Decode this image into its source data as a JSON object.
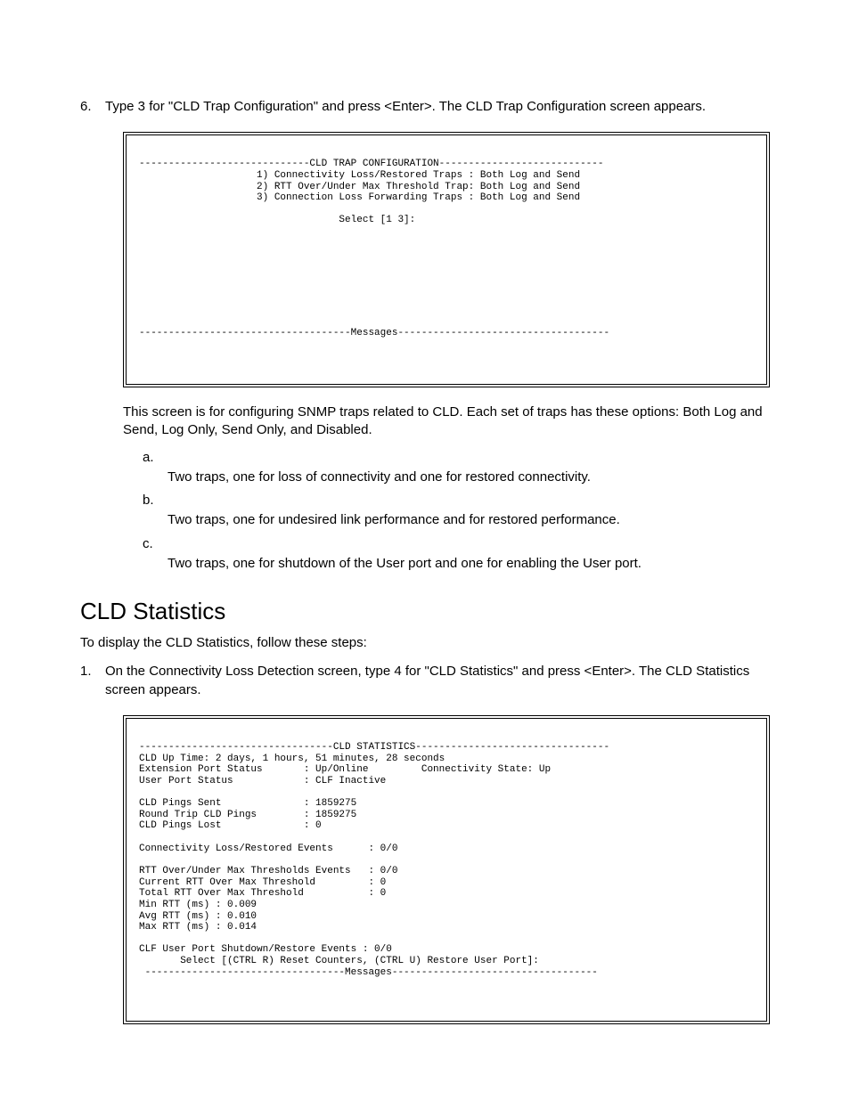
{
  "step6": {
    "num": "6.",
    "text": "Type 3 for \"CLD Trap Configuration\" and press <Enter>. The CLD Trap Configuration screen appears."
  },
  "term1": "-----------------------------CLD TRAP CONFIGURATION----------------------------\n                    1) Connectivity Loss/Restored Traps : Both Log and Send\n                    2) RTT Over/Under Max Threshold Trap: Both Log and Send\n                    3) Connection Loss Forwarding Traps : Both Log and Send\n\n                                  Select [1 3]:\n\n\n\n\n\n\n\n\n\n------------------------------------Messages------------------------------------\n\n",
  "after1": "This screen is for configuring SNMP traps related to CLD. Each set of traps has these options: Both Log and Send, Log Only, Send Only, and Disabled.",
  "subs": {
    "a": {
      "lbl": "a.",
      "desc": "Two traps, one for loss of connectivity and one for restored connectivity."
    },
    "b": {
      "lbl": "b.",
      "desc": "Two traps, one for undesired link performance and for restored performance."
    },
    "c": {
      "lbl": "c.",
      "desc": "Two traps, one for shutdown of the User port and one for enabling the User port."
    }
  },
  "heading2": "CLD Statistics",
  "intro2": "To display the CLD Statistics, follow these steps:",
  "step1b": {
    "num": "1.",
    "text": "On the Connectivity Loss Detection screen, type 4 for \"CLD Statistics\" and press <Enter>. The CLD Statistics screen appears."
  },
  "term2": "---------------------------------CLD STATISTICS---------------------------------\nCLD Up Time: 2 days, 1 hours, 51 minutes, 28 seconds\nExtension Port Status       : Up/Online         Connectivity State: Up\nUser Port Status            : CLF Inactive\n\nCLD Pings Sent              : 1859275\nRound Trip CLD Pings        : 1859275\nCLD Pings Lost              : 0\n\nConnectivity Loss/Restored Events      : 0/0\n\nRTT Over/Under Max Thresholds Events   : 0/0\nCurrent RTT Over Max Threshold         : 0\nTotal RTT Over Max Threshold           : 0\nMin RTT (ms) : 0.009\nAvg RTT (ms) : 0.010\nMax RTT (ms) : 0.014\n\nCLF User Port Shutdown/Restore Events : 0/0\n       Select [(CTRL R) Reset Counters, (CTRL U) Restore User Port]:\n ----------------------------------Messages-----------------------------------\n\n\n"
}
